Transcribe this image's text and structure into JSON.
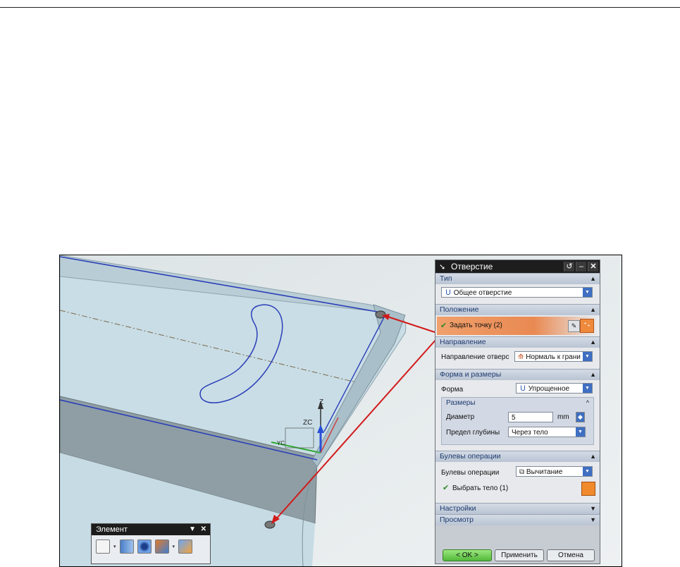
{
  "toolbar": {
    "title": "Элемент",
    "icons": [
      "sketch-plane-icon",
      "extrude-icon",
      "hole-icon",
      "boolean-icon",
      "block-icon"
    ]
  },
  "viewport": {
    "axis_z": "Z",
    "axis_zc": "ZC",
    "axis_yc": "YC"
  },
  "dialog": {
    "title": "Отверстие",
    "sections": {
      "type": {
        "title": "Тип",
        "value": "Общее отверстие"
      },
      "position": {
        "title": "Положение",
        "specify_point": "Задать точку (2)"
      },
      "direction": {
        "title": "Направление",
        "label": "Направление отверс",
        "value": "Нормаль к грани"
      },
      "form": {
        "title": "Форма и размеры",
        "form_label": "Форма",
        "form_value": "Упрощенное",
        "dims_title": "Размеры",
        "diameter_label": "Диаметр",
        "diameter_value": "5",
        "diameter_unit": "mm",
        "depth_label": "Предел глубины",
        "depth_value": "Через тело"
      },
      "boolean": {
        "title": "Булевы операции",
        "label": "Булевы операции",
        "value": "Вычитание",
        "select_body": "Выбрать тело (1)"
      },
      "settings": {
        "title": "Настройки"
      },
      "preview": {
        "title": "Просмотр"
      }
    },
    "buttons": {
      "ok": "< OK >",
      "apply": "Применить",
      "cancel": "Отмена"
    }
  },
  "colors": {
    "part_fill": "#c9dde6",
    "highlight": "#e98952",
    "ok_button": "#53b83b",
    "arrow": "#d21a1a",
    "edge": "#2a3fb8"
  }
}
